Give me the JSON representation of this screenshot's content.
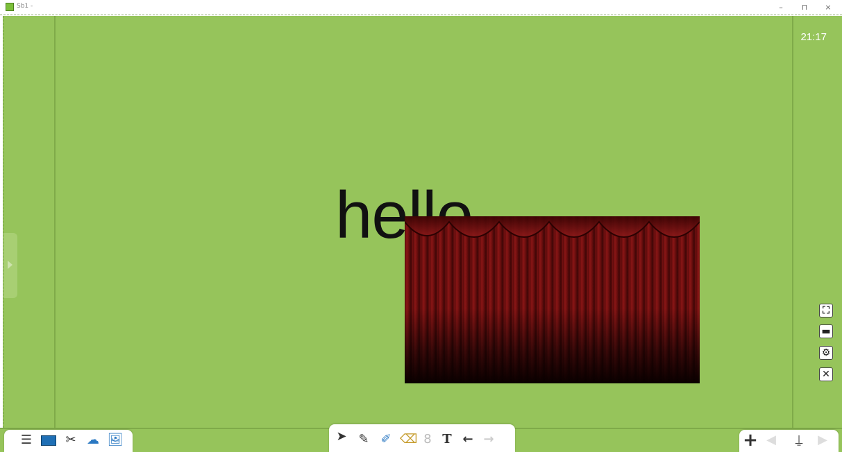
{
  "window": {
    "title": "Sb1 -",
    "minimize_glyph": "–",
    "restore_glyph": "⊓",
    "close_glyph": "×"
  },
  "canvas": {
    "clock": "21:17",
    "text": "hello"
  },
  "right_tools": [
    {
      "name": "fullscreen-icon",
      "glyph": "⛶"
    },
    {
      "name": "screen-icon",
      "glyph": "▬"
    },
    {
      "name": "settings-gear-icon",
      "glyph": "⚙"
    },
    {
      "name": "close-icon",
      "glyph": "✕"
    }
  ],
  "left_toolbar": [
    {
      "name": "menu-icon",
      "glyph": "☰"
    },
    {
      "name": "monitor-icon",
      "glyph": ""
    },
    {
      "name": "tools-icon",
      "glyph": "✂"
    },
    {
      "name": "cloud-icon",
      "glyph": "☁"
    },
    {
      "name": "image-icon",
      "glyph": "🖼"
    }
  ],
  "center_toolbar": [
    {
      "name": "select-cursor-icon",
      "glyph": "➤"
    },
    {
      "name": "pen-icon",
      "glyph": "✎"
    },
    {
      "name": "highlighter-icon",
      "glyph": "✐"
    },
    {
      "name": "eraser-icon",
      "glyph": "⌫"
    },
    {
      "name": "lasso-icon",
      "glyph": "8"
    },
    {
      "name": "text-tool-icon",
      "glyph": "T"
    },
    {
      "name": "undo-icon",
      "glyph": "←"
    },
    {
      "name": "redo-icon",
      "glyph": "→"
    }
  ],
  "right_toolbar": [
    {
      "name": "add-page-icon",
      "glyph": "+"
    },
    {
      "name": "prev-page-icon",
      "glyph": "◀"
    },
    {
      "name": "page-list-icon",
      "glyph": "⍊"
    },
    {
      "name": "next-page-icon",
      "glyph": "▶"
    }
  ],
  "colors": {
    "canvas_bg": "#96c45b",
    "curtain_red": "#7a1212",
    "clock_text": "#ffffff"
  }
}
